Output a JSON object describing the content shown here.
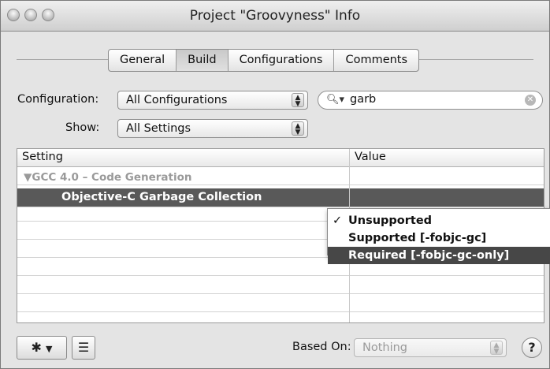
{
  "window": {
    "title": "Project \"Groovyness\" Info"
  },
  "tabs": [
    {
      "label": "General"
    },
    {
      "label": "Build"
    },
    {
      "label": "Configurations"
    },
    {
      "label": "Comments"
    }
  ],
  "configuration": {
    "label": "Configuration:",
    "value": "All Configurations"
  },
  "show": {
    "label": "Show:",
    "value": "All Settings"
  },
  "search": {
    "value": "garb"
  },
  "table": {
    "headers": {
      "setting": "Setting",
      "value": "Value"
    },
    "group": "▼GCC 4.0 – Code Generation",
    "selected_setting": "Objective-C Garbage Collection"
  },
  "menu": {
    "check": "✓",
    "items": [
      {
        "label": "Unsupported"
      },
      {
        "label": "Supported [-fobjc-gc]"
      },
      {
        "label": "Required [-fobjc-gc-only]"
      }
    ]
  },
  "bottom": {
    "based_on_label": "Based On:",
    "based_on_value": "Nothing",
    "help": "?"
  },
  "icons": {
    "gear": "gear-icon",
    "dropdown": "chevron-down-icon",
    "list": "list-icon",
    "search": "search-icon",
    "clear": "clear-icon"
  }
}
